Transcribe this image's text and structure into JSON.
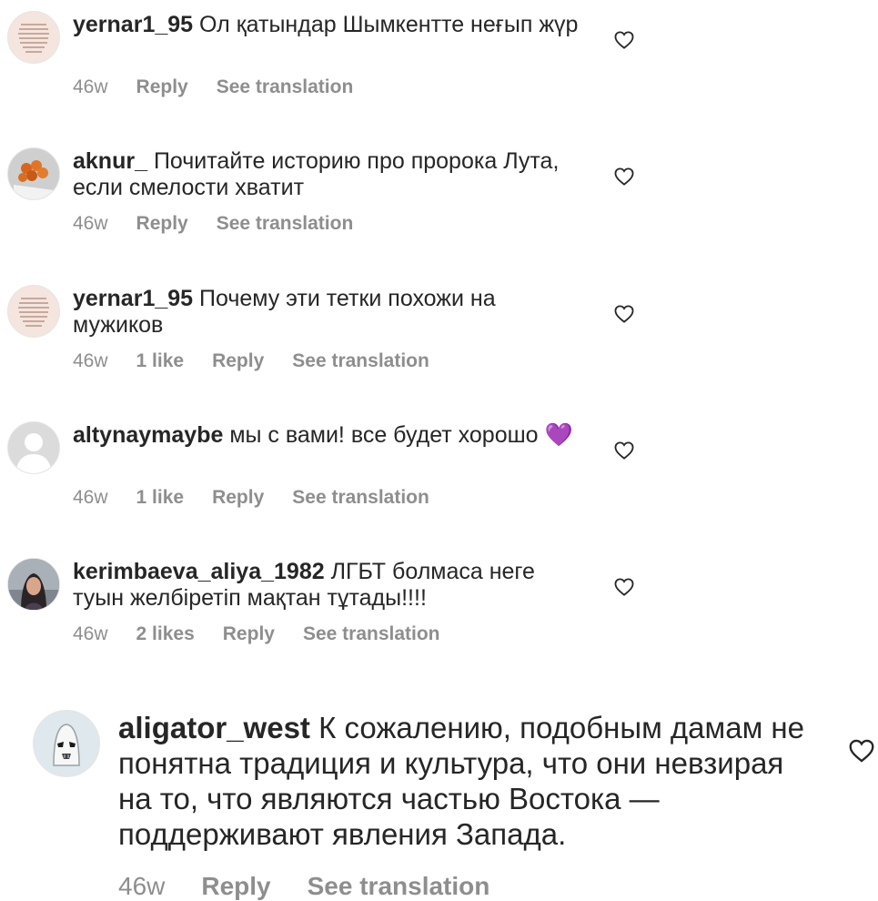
{
  "comments": [
    {
      "username": "yernar1_95",
      "text": "Ол қатындар Шымкентте неғып жүр",
      "time": "46w",
      "likes": "",
      "reply": "Reply",
      "translate": "See translation",
      "avatar": "quote-card-avatar"
    },
    {
      "username": "aknur_",
      "text": "Почитайте историю про пророка Лута, если смелости хватит",
      "time": "46w",
      "likes": "",
      "reply": "Reply",
      "translate": "See translation",
      "avatar": "food-photo-avatar"
    },
    {
      "username": "yernar1_95",
      "text": "Почему эти тетки похожи на мужиков",
      "time": "46w",
      "likes": "1 like",
      "reply": "Reply",
      "translate": "See translation",
      "avatar": "quote-card-avatar"
    },
    {
      "username": "altynaymaybe",
      "text": "мы с вами! все будет хорошо",
      "emoji": "💜",
      "time": "46w",
      "likes": "1 like",
      "reply": "Reply",
      "translate": "See translation",
      "avatar": "default-user-avatar"
    },
    {
      "username": "kerimbaeva_aliya_1982",
      "text": "ЛГБТ  болмаса неге туын желбіретіп мақтан тұтады!!!!",
      "time": "46w",
      "likes": "2 likes",
      "reply": "Reply",
      "translate": "See translation",
      "avatar": "portrait-photo-avatar"
    },
    {
      "username": "aligator_west",
      "text": "К сожалению, подобным дамам не понятна традиция и культура, что они невзирая на то, что являются частью Востока — поддерживают явления Запада.",
      "time": "46w",
      "likes": "",
      "reply": "Reply",
      "translate": "See translation",
      "avatar": "stormtrooper-avatar"
    }
  ],
  "colors": {
    "text": "#262626",
    "meta": "#8e8e8e",
    "heart_outline": "#262626",
    "emoji_purple": "#a64bf4"
  }
}
